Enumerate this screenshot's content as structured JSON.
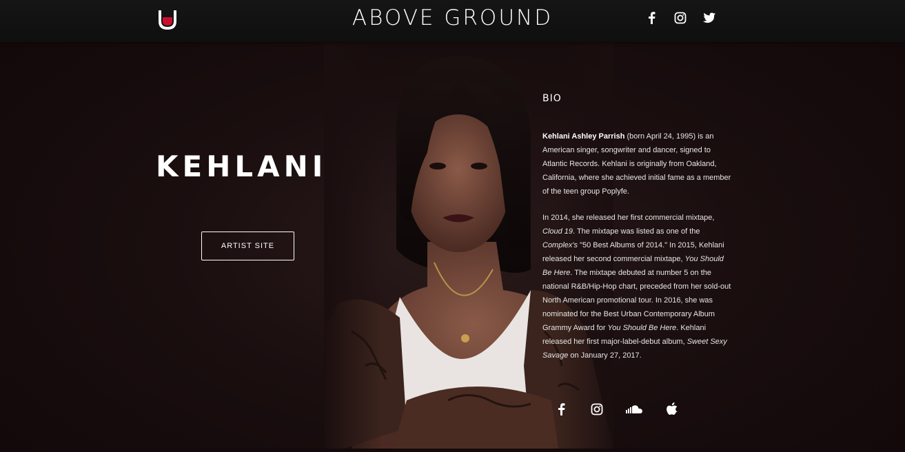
{
  "header": {
    "brand_part1": "ABOVE",
    "brand_part2": "GROUND",
    "logo_icon": "u-logo-icon",
    "social_icons": [
      "facebook-icon",
      "instagram-icon",
      "twitter-icon"
    ]
  },
  "artist": {
    "name": "KEHLANI",
    "site_button": "ARTIST SITE"
  },
  "bio": {
    "title": "BIO",
    "p1_bold": "Kehlani Ashley Parrish",
    "p1_rest": " (born April 24, 1995) is an American singer, songwriter and dancer, signed to Atlantic Records. Kehlani is originally from Oakland, California, where she achieved initial fame as a member of the teen group Poplyfe.",
    "p2_a": "In 2014, she released her first commercial mixtape, ",
    "p2_cloud": "Cloud 19",
    "p2_b": ". The mixtape was listed as one of the ",
    "p2_complex": "Complex's",
    "p2_c": " \"50 Best Albums of 2014.\" In 2015, Kehlani released her second commercial mixtape, ",
    "p2_ysbh1": "You Should Be Here",
    "p2_d": ". The mixtape debuted at number 5 on the national R&B/Hip-Hop chart, preceded from her sold-out North American promotional tour. In 2016, she was nominated for the Best Urban Contemporary Album Grammy Award for ",
    "p2_ysbh2": "You Should Be Here",
    "p2_e": ". Kehlani released her first major-label-debut album, ",
    "p2_sss": "Sweet Sexy Savage",
    "p2_f": " on January 27, 2017.",
    "social_icons": [
      "facebook-icon",
      "instagram-icon",
      "soundcloud-icon",
      "apple-icon"
    ]
  },
  "colors": {
    "logo_red": "#c8102e",
    "background": "#140a0b",
    "header": "#121212"
  }
}
